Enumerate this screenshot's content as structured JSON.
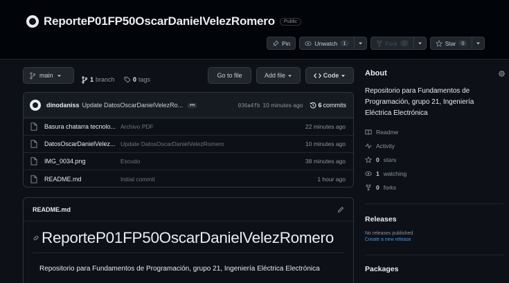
{
  "repo": {
    "name": "ReporteP01FP50OscarDanielVelezRomero",
    "visibility": "Public"
  },
  "actions": {
    "pin": "Pin",
    "unwatch": "Unwatch",
    "watch_count": "1",
    "fork": "Fork",
    "fork_count": "0",
    "star": "Star",
    "star_count": "0"
  },
  "toolbar": {
    "branch": "main",
    "branches_count": "1",
    "branches_label": "branch",
    "tags_count": "0",
    "tags_label": "tags",
    "go_to_file": "Go to file",
    "add_file": "Add file",
    "code": "Code"
  },
  "latest_commit": {
    "author": "dinodaniss",
    "message": "Update DatosOscarDanielVelezRo...",
    "sha": "036a4fb",
    "time": "10 minutes ago",
    "commit_count": "6",
    "commits_label": "commits"
  },
  "files": [
    {
      "name": "Basura chatarra tecnolo...",
      "commit": "Archivo PDF",
      "time": "22 minutes ago"
    },
    {
      "name": "DatosOscarDanielVelez...",
      "commit": "Update DatosOscarDanielVelezRomero",
      "time": "10 minutes ago"
    },
    {
      "name": "IMG_0034.png",
      "commit": "Escudo",
      "time": "38 minutes ago"
    },
    {
      "name": "README.md",
      "commit": "Initial commit",
      "time": "1 hour ago"
    }
  ],
  "readme": {
    "filename": "README.md",
    "heading": "ReporteP01FP50OscarDanielVelezRomero",
    "body": "Repositorio para Fundamentos de Programación, grupo 21, Ingeniería Eléctrica Electrónica"
  },
  "about": {
    "title": "About",
    "description": "Repositorio para Fundamentos de Programación, grupo 21, Ingeniería Eléctrica Electrónica",
    "readme": "Readme",
    "activity": "Activity",
    "stars_count": "0",
    "stars_label": "stars",
    "watching_count": "1",
    "watching_label": "watching",
    "forks_count": "0",
    "forks_label": "forks"
  },
  "releases": {
    "title": "Releases",
    "none": "No releases published",
    "create": "Create a new release"
  },
  "packages": {
    "title": "Packages"
  },
  "colors": {
    "background": "#0d1117",
    "code_button": "#238636",
    "link": "#4493f8"
  }
}
